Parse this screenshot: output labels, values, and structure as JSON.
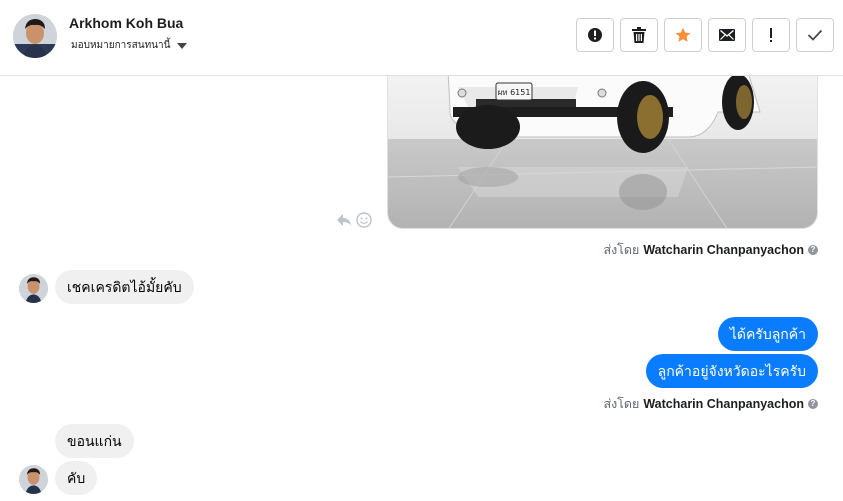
{
  "header": {
    "contact_name": "Arkhom Koh Bua",
    "assign_label": "มอบหมายการสนทนานี้",
    "actions": [
      {
        "name": "alert-circle-icon",
        "label": "Mark as spam"
      },
      {
        "name": "trash-icon",
        "label": "Delete"
      },
      {
        "name": "star-icon",
        "label": "Star"
      },
      {
        "name": "envelope-icon",
        "label": "Mark unread"
      },
      {
        "name": "exclamation-icon",
        "label": "Follow up"
      },
      {
        "name": "check-icon",
        "label": "Done"
      }
    ]
  },
  "colors": {
    "outgoing_bubble": "#0a7cff",
    "incoming_bubble": "#f0f0f0",
    "star": "#f7923b"
  },
  "messages": [
    {
      "type": "image",
      "direction": "out",
      "alt": "White pickup truck in showroom",
      "plate": "ผท 6151"
    },
    {
      "type": "sent_by",
      "prefix": "ส่งโดย",
      "agent": "Watcharin Chanpanyachon"
    },
    {
      "type": "text",
      "direction": "in",
      "text": "เชคเครดิตไอ้มั้ยคับ"
    },
    {
      "type": "text",
      "direction": "out",
      "text": "ได้ครับลูกค้า"
    },
    {
      "type": "text",
      "direction": "out",
      "text": "ลูกค้าอยู่จังหวัดอะไรครับ"
    },
    {
      "type": "sent_by",
      "prefix": "ส่งโดย",
      "agent": "Watcharin Chanpanyachon"
    },
    {
      "type": "text",
      "direction": "in",
      "text": "ขอนแก่น"
    },
    {
      "type": "text",
      "direction": "in",
      "text": "คับ"
    }
  ]
}
